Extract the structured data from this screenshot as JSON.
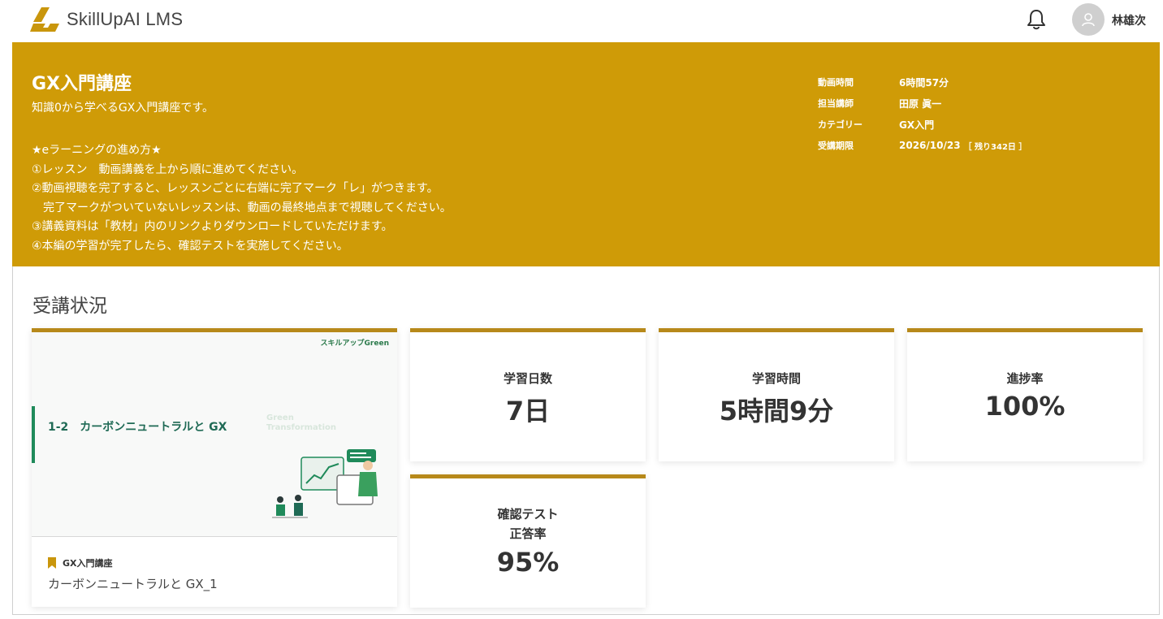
{
  "header": {
    "app_name": "SkillUpAI LMS",
    "user_name": "林雄次",
    "brand_color": "#cf9b07"
  },
  "banner": {
    "title": "GX入門講座",
    "description": "知識0から学べるGX入門講座です。",
    "instructions": [
      "★eラーニングの進め方★",
      "①レッスン　動画講義を上から順に進めてください。",
      "②動画視聴を完了すると、レッスンごとに右端に完了マーク「レ」がつきます。",
      "　完了マークがついていないレッスンは、動画の最終地点まで視聴してください。",
      "③講義資料は「教材」内のリンクよりダウンロードしていただけます。",
      "④本編の学習が完了したら、確認テストを実施してください。"
    ],
    "meta": {
      "video_time_label": "動画時間",
      "video_time_value": "6時間57分",
      "instructor_label": "担当講師",
      "instructor_value": "田原 眞一",
      "category_label": "カテゴリー",
      "category_value": "GX入門",
      "deadline_label": "受講期限",
      "deadline_value": "2026/10/23",
      "deadline_remaining": "［ 残り342日 ］"
    }
  },
  "status": {
    "section_title": "受講状況",
    "lesson_card": {
      "brand_tag": "スキルアップGreen",
      "thumb_heading": "1-2　カーボンニュートラルと GX",
      "thumb_watermark": "Green\nTransformation",
      "course_tag": "GX入門講座",
      "lesson_name": "カーボンニュートラルと GX_1"
    },
    "stats": {
      "days_label": "学習日数",
      "days_value": "7日",
      "time_label": "学習時間",
      "time_value": "5時間9分",
      "progress_label": "進捗率",
      "progress_value": "100%",
      "test_label_line1": "確認テスト",
      "test_label_line2": "正答率",
      "test_value": "95%"
    }
  }
}
